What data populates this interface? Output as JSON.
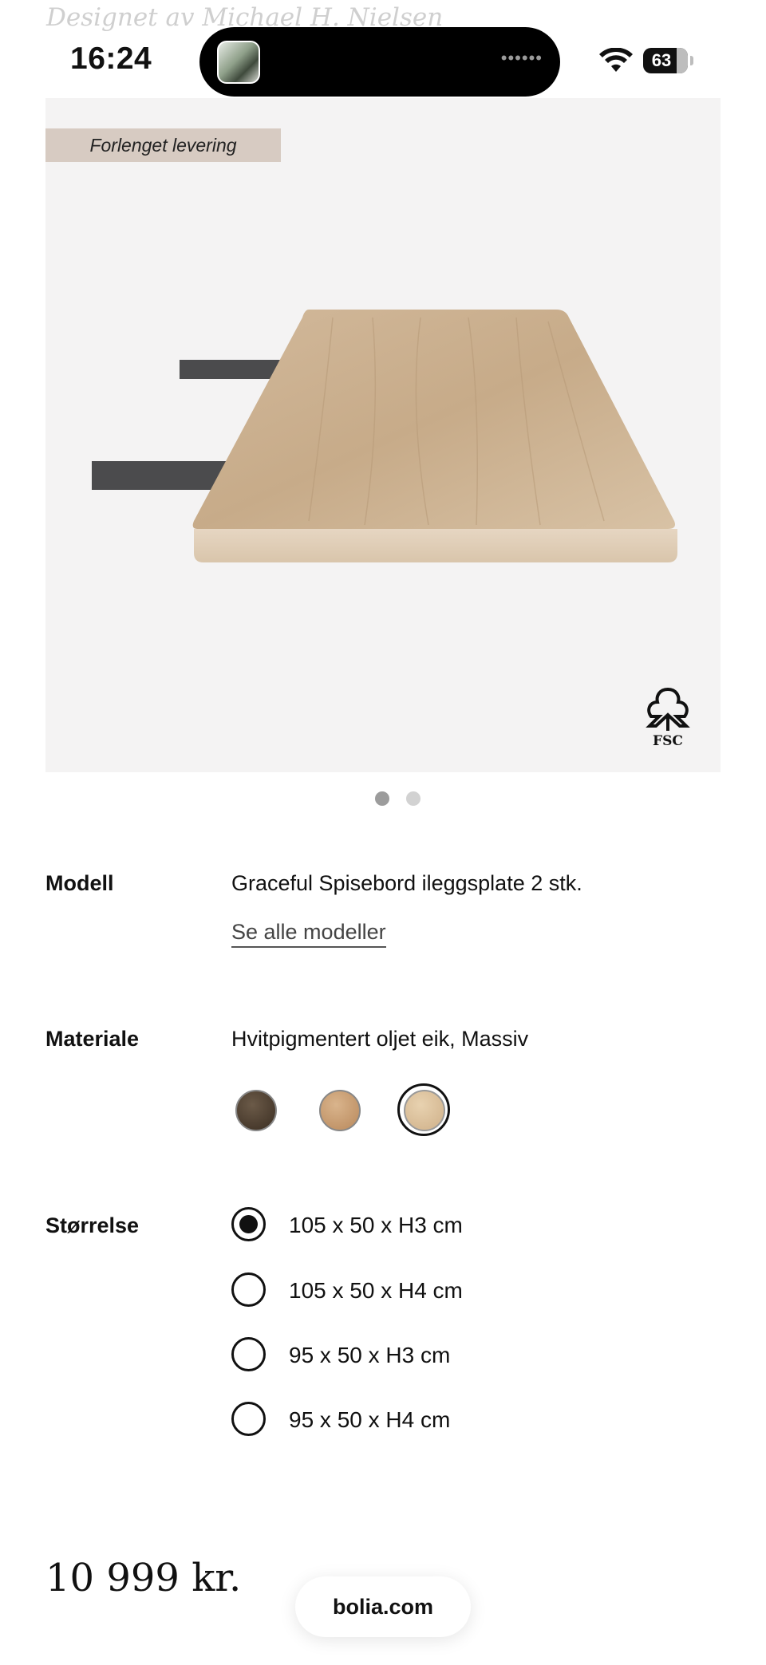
{
  "header": {
    "designer_text": "Designet av Michael H. Nielsen"
  },
  "status_bar": {
    "time": "16:24",
    "battery": "63"
  },
  "product_image": {
    "badge": "Forlenget levering",
    "certification": "FSC",
    "page_count": 2,
    "active_page": 1
  },
  "product": {
    "model_label": "Modell",
    "model_value": "Graceful Spisebord ileggsplate 2 stk.",
    "see_all_models": "Se alle modeller",
    "material_label": "Materiale",
    "material_value": "Hvitpigmentert oljet eik, Massiv",
    "material_swatches": [
      {
        "name": "dark-oak",
        "color": "#4a3b2d"
      },
      {
        "name": "oak",
        "color": "#c99f72"
      },
      {
        "name": "white-pigmented-oak",
        "color": "#ddc29e",
        "selected": true
      }
    ],
    "size_label": "Størrelse",
    "sizes": [
      {
        "label": "105 x 50 x H3 cm",
        "selected": true
      },
      {
        "label": "105 x 50 x H4 cm",
        "selected": false
      },
      {
        "label": "95 x 50 x H3 cm",
        "selected": false
      },
      {
        "label": "95 x 50 x H4 cm",
        "selected": false
      }
    ]
  },
  "footer": {
    "price": "10 999 kr.",
    "site": "bolia.com"
  }
}
